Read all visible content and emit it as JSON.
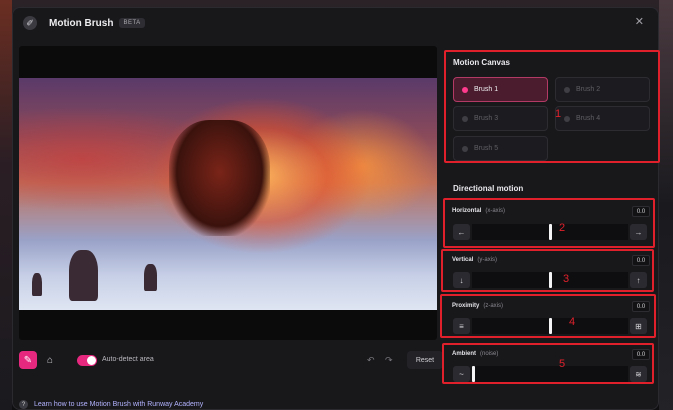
{
  "window": {
    "title": "Motion Brush",
    "badge": "BETA",
    "close_icon": "close-icon"
  },
  "motion_canvas": {
    "title": "Motion Canvas",
    "brushes": [
      {
        "label": "Brush 1",
        "active": true
      },
      {
        "label": "Brush 2",
        "active": false
      },
      {
        "label": "Brush 3",
        "active": false
      },
      {
        "label": "Brush 4",
        "active": false
      },
      {
        "label": "Brush 5",
        "active": false
      }
    ]
  },
  "directional_motion": {
    "title": "Directional motion",
    "controls": [
      {
        "label": "Horizontal",
        "axis": "(x-axis)",
        "value": "0.0",
        "left_icon": "arrow-left-icon",
        "right_icon": "arrow-right-icon",
        "left_glyph": "←",
        "right_glyph": "→"
      },
      {
        "label": "Vertical",
        "axis": "(y-axis)",
        "value": "0.0",
        "left_icon": "arrow-down-icon",
        "right_icon": "arrow-up-icon",
        "left_glyph": "↓",
        "right_glyph": "↑"
      },
      {
        "label": "Proximity",
        "axis": "(z-axis)",
        "value": "0.0",
        "left_icon": "layers-icon",
        "right_icon": "expand-icon",
        "left_glyph": "≡",
        "right_glyph": "⊞"
      },
      {
        "label": "Ambient",
        "axis": "(noise)",
        "value": "0.0",
        "left_icon": "wave-icon",
        "right_icon": "noise-icon",
        "left_glyph": "~",
        "right_glyph": "≋"
      }
    ]
  },
  "annotations": [
    "1",
    "2",
    "3",
    "4",
    "5"
  ],
  "toolbar": {
    "brush_icon": "brush-icon",
    "eraser_icon": "eraser-icon",
    "auto_detect_label": "Auto-detect area",
    "auto_detect_on": true,
    "undo_icon": "undo-icon",
    "redo_icon": "redo-icon",
    "reset_label": "Reset"
  },
  "footer": {
    "learn_link": "Learn how to use Motion Brush with Runway Academy"
  },
  "colors": {
    "accent": "#ff3b8d",
    "annotation": "#e0212b"
  }
}
